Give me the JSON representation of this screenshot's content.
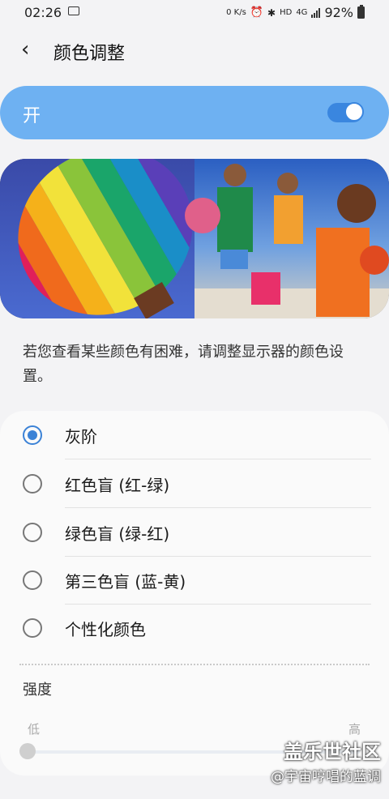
{
  "status_bar": {
    "time": "02:26",
    "net_speed": "0 K/s",
    "hd": "HD",
    "network": "4G",
    "battery": "92%"
  },
  "header": {
    "title": "颜色调整"
  },
  "switch": {
    "label": "开",
    "on": true
  },
  "description": "若您查看某些颜色有困难，请调整显示器的颜色设置。",
  "options": [
    {
      "label": "灰阶",
      "selected": true
    },
    {
      "label": "红色盲 (红-绿)",
      "selected": false
    },
    {
      "label": "绿色盲 (绿-红)",
      "selected": false
    },
    {
      "label": "第三色盲 (蓝-黄)",
      "selected": false
    },
    {
      "label": "个性化颜色",
      "selected": false
    }
  ],
  "intensity": {
    "label": "强度",
    "low_label": "低",
    "high_label": "高",
    "value": 0
  },
  "watermark": {
    "line1": "盖乐世社区",
    "line2": "@宇宙哼唱的蓝调"
  },
  "colors": {
    "accent": "#3b82d6",
    "switch_card": "#6eb1f2"
  }
}
